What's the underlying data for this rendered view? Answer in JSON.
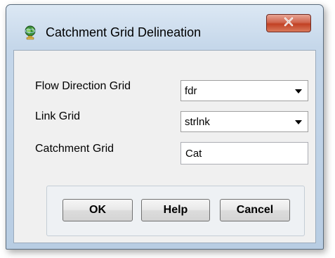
{
  "window": {
    "title": "Catchment Grid Delineation",
    "icon": "globe-icon"
  },
  "form": {
    "flow_direction": {
      "label": "Flow Direction Grid",
      "value": "fdr"
    },
    "link_grid": {
      "label": "Link Grid",
      "value": "strlnk"
    },
    "catchment_grid": {
      "label": "Catchment Grid",
      "value": "Cat"
    }
  },
  "buttons": {
    "ok": "OK",
    "help": "Help",
    "cancel": "Cancel"
  },
  "colors": {
    "title_gradient_top": "#dce8f4",
    "close_button": "#c24124",
    "client_background": "#f0f0f0"
  }
}
